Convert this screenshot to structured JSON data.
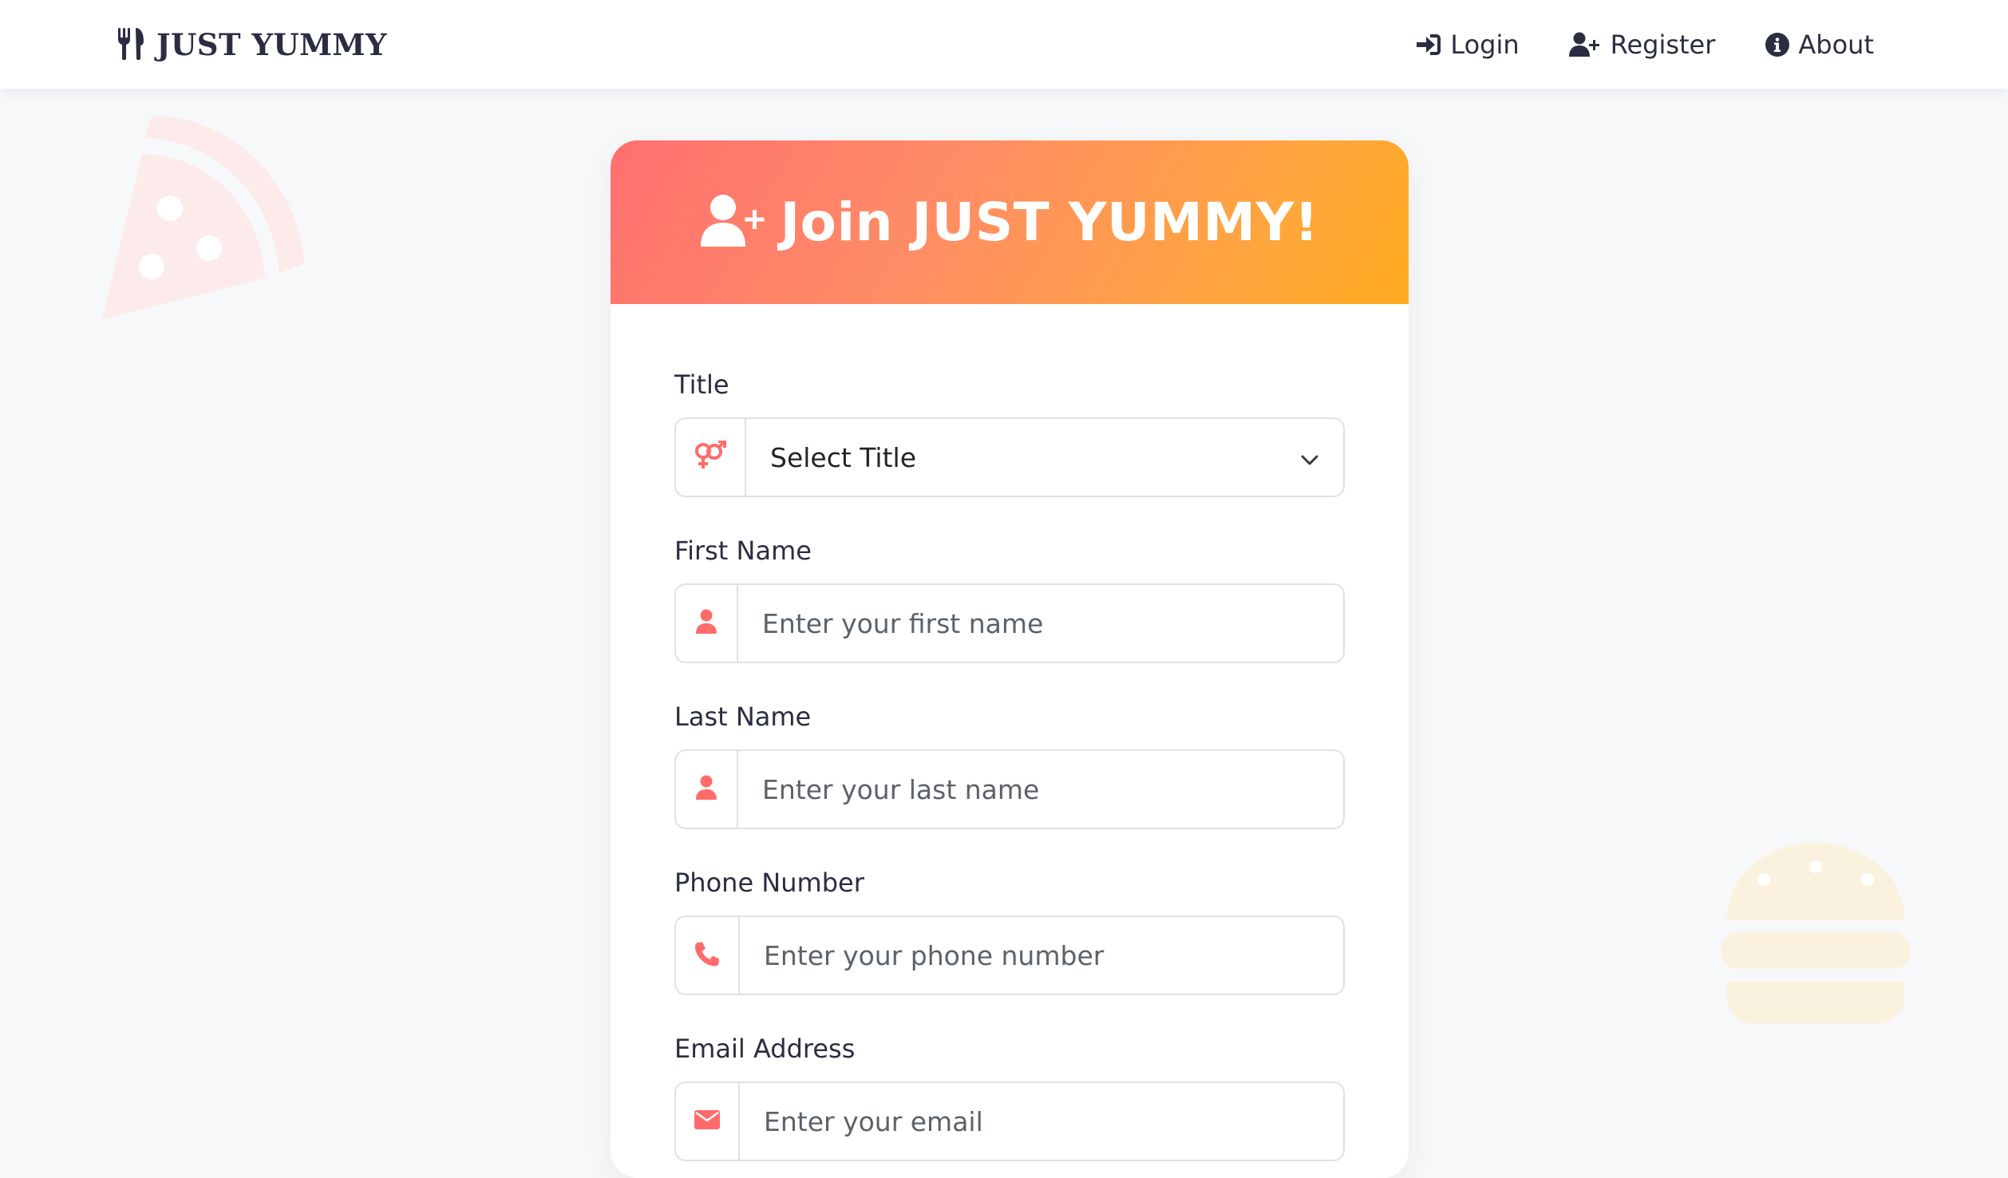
{
  "nav": {
    "brand": "JUST YUMMY",
    "links": [
      {
        "label": "Login",
        "icon": "sign-in-icon"
      },
      {
        "label": "Register",
        "icon": "user-plus-icon"
      },
      {
        "label": "About",
        "icon": "info-circle-icon"
      }
    ]
  },
  "form": {
    "heading": "Join JUST YUMMY!",
    "title_label": "Title",
    "title_select_value": "Select Title",
    "first_name_label": "First Name",
    "first_name_placeholder": "Enter your first name",
    "last_name_label": "Last Name",
    "last_name_placeholder": "Enter your last name",
    "phone_label": "Phone Number",
    "phone_placeholder": "Enter your phone number",
    "email_label": "Email Address",
    "email_placeholder": "Enter your email"
  },
  "colors": {
    "accent": "#ff6b6b",
    "gradient_start": "#ff6f6f",
    "gradient_end": "#ffaa1f",
    "nav_text": "#2b2d42"
  }
}
